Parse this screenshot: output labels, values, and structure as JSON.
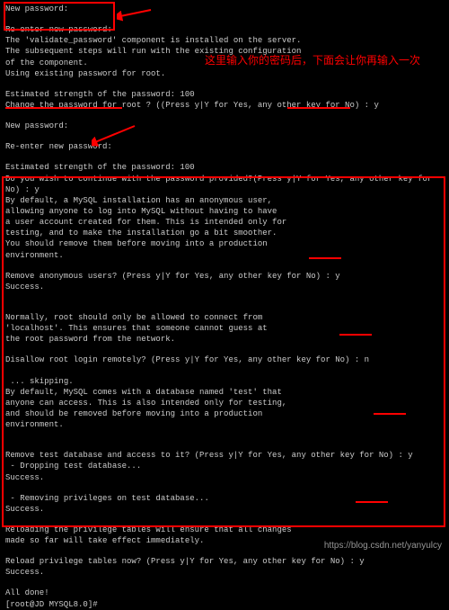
{
  "annotation": "这里输入你的密码后，下面会让你再输入一次",
  "watermark": "https://blog.csdn.net/yanyulcy",
  "lines": {
    "l0": "New password:",
    "l1": "",
    "l2": "Re-enter new password:",
    "l3": "The 'validate_password' component is installed on the server.",
    "l4": "The subsequent steps will run with the existing configuration",
    "l5": "of the component.",
    "l6": "Using existing password for root.",
    "l7": "",
    "l8": "Estimated strength of the password: 100",
    "l9": "Change the password for root ? ((Press y|Y for Yes, any other key for No) : y",
    "l10": "",
    "l11": "New password:",
    "l12": "",
    "l13": "Re-enter new password:",
    "l14": "",
    "l15": "Estimated strength of the password: 100",
    "l16": "Do you wish to continue with the password provided?(Press y|Y for Yes, any other key for No) : y",
    "l17": "By default, a MySQL installation has an anonymous user,",
    "l18": "allowing anyone to log into MySQL without having to have",
    "l19": "a user account created for them. This is intended only for",
    "l20": "testing, and to make the installation go a bit smoother.",
    "l21": "You should remove them before moving into a production",
    "l22": "environment.",
    "l23": "",
    "l24": "Remove anonymous users? (Press y|Y for Yes, any other key for No) : y",
    "l25": "Success.",
    "l26": "",
    "l27": "",
    "l28": "Normally, root should only be allowed to connect from",
    "l29": "'localhost'. This ensures that someone cannot guess at",
    "l30": "the root password from the network.",
    "l31": "",
    "l32": "Disallow root login remotely? (Press y|Y for Yes, any other key for No) : n",
    "l33": "",
    "l34": " ... skipping.",
    "l35": "By default, MySQL comes with a database named 'test' that",
    "l36": "anyone can access. This is also intended only for testing,",
    "l37": "and should be removed before moving into a production",
    "l38": "environment.",
    "l39": "",
    "l40": "",
    "l41": "Remove test database and access to it? (Press y|Y for Yes, any other key for No) : y",
    "l42": " - Dropping test database...",
    "l43": "Success.",
    "l44": "",
    "l45": " - Removing privileges on test database...",
    "l46": "Success.",
    "l47": "",
    "l48": "Reloading the privilege tables will ensure that all changes",
    "l49": "made so far will take effect immediately.",
    "l50": "",
    "l51": "Reload privilege tables now? (Press y|Y for Yes, any other key for No) : y",
    "l52": "Success.",
    "l53": "",
    "l54": "All done!",
    "l55": "[root@JD MYSQL8.0]# "
  }
}
